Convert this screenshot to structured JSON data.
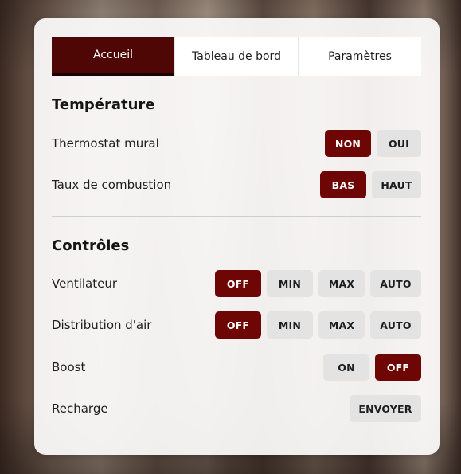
{
  "tabs": [
    {
      "label": "Accueil",
      "active": true
    },
    {
      "label": "Tableau de bord",
      "active": false
    },
    {
      "label": "Paramètres",
      "active": false
    }
  ],
  "temperature": {
    "title": "Température",
    "thermostat": {
      "label": "Thermostat mural",
      "options": [
        "NON",
        "OUI"
      ],
      "selected": "NON"
    },
    "combustion": {
      "label": "Taux de combustion",
      "options": [
        "BAS",
        "HAUT"
      ],
      "selected": "BAS"
    }
  },
  "controles": {
    "title": "Contrôles",
    "ventilateur": {
      "label": "Ventilateur",
      "options": [
        "OFF",
        "MIN",
        "MAX",
        "AUTO"
      ],
      "selected": "OFF"
    },
    "distribution": {
      "label": "Distribution d'air",
      "options": [
        "OFF",
        "MIN",
        "MAX",
        "AUTO"
      ],
      "selected": "OFF"
    },
    "boost": {
      "label": "Boost",
      "options": [
        "ON",
        "OFF"
      ],
      "selected": "OFF"
    },
    "recharge": {
      "label": "Recharge",
      "button": "ENVOYER"
    }
  },
  "colors": {
    "accent": "#6d0605",
    "active_tab": "#4e0705",
    "button_bg": "#e3e3e3"
  }
}
